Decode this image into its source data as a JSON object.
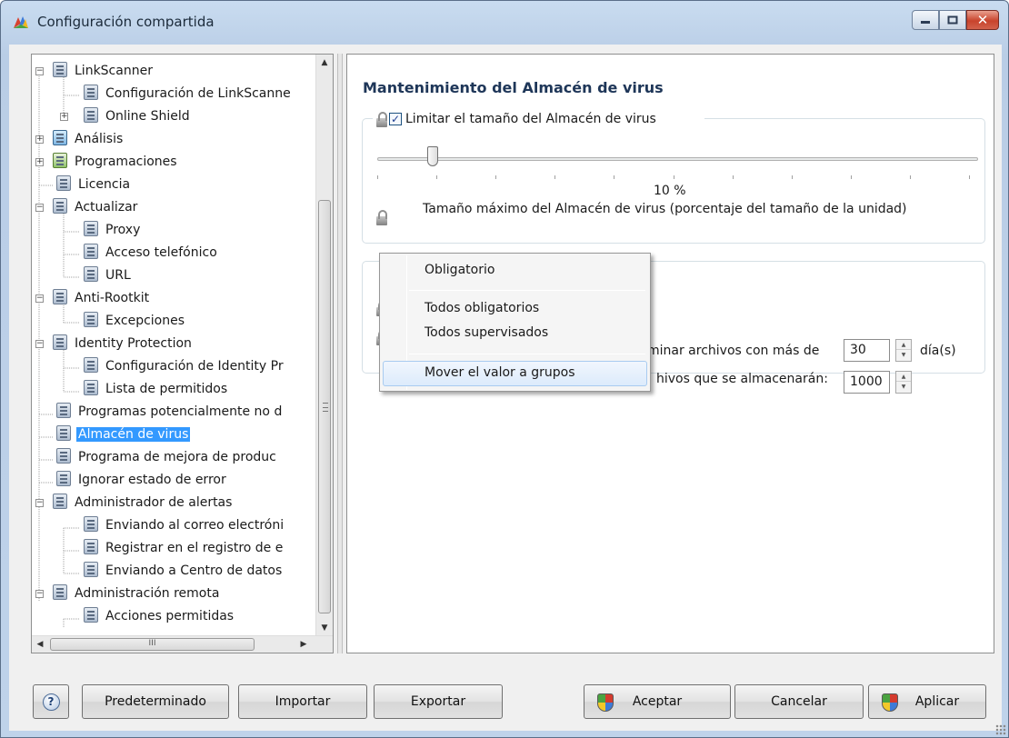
{
  "window": {
    "title": "Configuración compartida",
    "app_icon": "avg-logo-icon",
    "buttons": [
      "minimize",
      "maximize",
      "close"
    ]
  },
  "tree": {
    "items": [
      {
        "label": "LinkScanner",
        "expanded": true,
        "icon": "settings-node-icon"
      },
      {
        "label": "Configuración de LinkScanne",
        "icon": "settings-node-icon"
      },
      {
        "label": "Online Shield",
        "expanded": false,
        "icon": "settings-node-icon"
      },
      {
        "label": "Análisis",
        "expanded": false,
        "icon": "scan-icon"
      },
      {
        "label": "Programaciones",
        "expanded": false,
        "icon": "schedule-icon"
      },
      {
        "label": "Licencia",
        "icon": "settings-node-icon"
      },
      {
        "label": "Actualizar",
        "expanded": true,
        "icon": "settings-node-icon"
      },
      {
        "label": "Proxy",
        "icon": "settings-node-icon"
      },
      {
        "label": "Acceso telefónico",
        "icon": "settings-node-icon"
      },
      {
        "label": "URL",
        "icon": "settings-node-icon"
      },
      {
        "label": "Anti-Rootkit",
        "expanded": true,
        "icon": "settings-node-icon"
      },
      {
        "label": "Excepciones",
        "icon": "settings-node-icon"
      },
      {
        "label": "Identity Protection",
        "expanded": true,
        "icon": "settings-node-icon"
      },
      {
        "label": "Configuración de Identity Pr",
        "icon": "settings-node-icon"
      },
      {
        "label": "Lista de permitidos",
        "icon": "settings-node-icon"
      },
      {
        "label": "Programas potencialmente no d",
        "icon": "settings-node-icon"
      },
      {
        "label": "Almacén de virus",
        "selected": true,
        "icon": "settings-node-icon"
      },
      {
        "label": "Programa de mejora de produc",
        "icon": "settings-node-icon"
      },
      {
        "label": "Ignorar estado de error",
        "icon": "settings-node-icon"
      },
      {
        "label": "Administrador de alertas",
        "expanded": true,
        "icon": "settings-node-icon"
      },
      {
        "label": "Enviando al correo electróni",
        "icon": "settings-node-icon"
      },
      {
        "label": "Registrar en el registro de e",
        "icon": "settings-node-icon"
      },
      {
        "label": "Enviando a Centro de datos",
        "icon": "settings-node-icon"
      },
      {
        "label": "Administración remota",
        "expanded": true,
        "icon": "settings-node-icon"
      },
      {
        "label": "Acciones permitidas",
        "icon": "settings-node-icon"
      }
    ],
    "hscroll_thumb_grip": "III"
  },
  "content": {
    "section_title": "Mantenimiento del Almacén de virus",
    "limit_checkbox": {
      "label": "Limitar el tamaño del Almacén de virus",
      "checked": true
    },
    "slider": {
      "value_percent": 10,
      "value_label": "10 %",
      "min": 0,
      "max": 100
    },
    "slider_caption": "Tamaño máximo del Almacén de virus (porcentaje del tamaño de la unidad)",
    "days_row": {
      "label_visible": "minar archivos con más de",
      "value": "30",
      "unit": "día(s)"
    },
    "files_row": {
      "label_visible": "hivos que se almacenarán:",
      "value": "1000"
    }
  },
  "context_menu": {
    "items": [
      {
        "label": "Obligatorio"
      },
      {
        "label": "Todos obligatorios"
      },
      {
        "label": "Todos supervisados"
      },
      {
        "label": "Mover el valor a grupos",
        "hovered": true
      }
    ]
  },
  "footer": {
    "help_label": "?",
    "default_label": "Predeterminado",
    "import_label": "Importar",
    "export_label": "Exportar",
    "accept_label": "Aceptar",
    "cancel_label": "Cancelar",
    "apply_label": "Aplicar"
  },
  "colors": {
    "selection": "#3399ff",
    "title_text": "#1e3658",
    "window_frame": "#b9cde6"
  }
}
